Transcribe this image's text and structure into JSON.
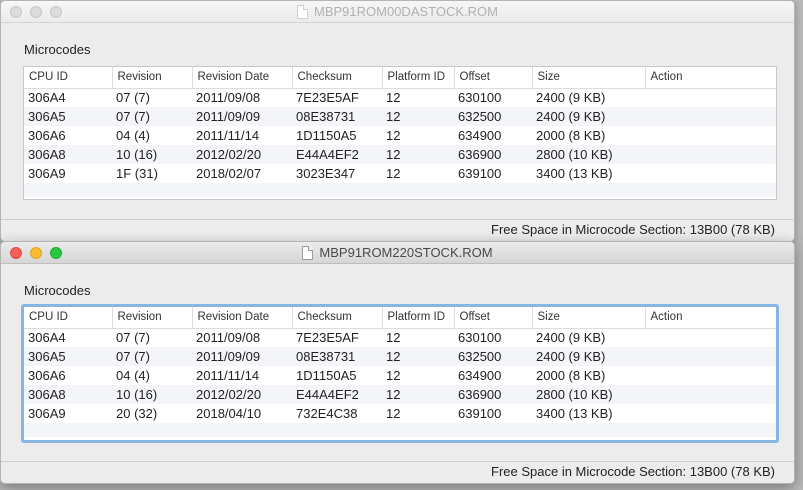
{
  "columns": [
    "CPU ID",
    "Revision",
    "Revision Date",
    "Checksum",
    "Platform ID",
    "Offset",
    "Size",
    "Action"
  ],
  "windows": [
    {
      "title": "MBP91ROM00DASTOCK.ROM",
      "section_label": "Microcodes",
      "rows": [
        [
          "306A4",
          "07 (7)",
          "2011/09/08",
          "7E23E5AF",
          "12",
          "630100",
          "2400 (9 KB)",
          ""
        ],
        [
          "306A5",
          "07 (7)",
          "2011/09/09",
          "08E38731",
          "12",
          "632500",
          "2400 (9 KB)",
          ""
        ],
        [
          "306A6",
          "04 (4)",
          "2011/11/14",
          "1D1150A5",
          "12",
          "634900",
          "2000 (8 KB)",
          ""
        ],
        [
          "306A8",
          "10 (16)",
          "2012/02/20",
          "E44A4EF2",
          "12",
          "636900",
          "2800 (10 KB)",
          ""
        ],
        [
          "306A9",
          "1F (31)",
          "2018/02/07",
          "3023E347",
          "12",
          "639100",
          "3400 (13 KB)",
          ""
        ]
      ],
      "free_space": "Free Space in Microcode Section: 13B00 (78 KB)"
    },
    {
      "title": "MBP91ROM220STOCK.ROM",
      "section_label": "Microcodes",
      "rows": [
        [
          "306A4",
          "07 (7)",
          "2011/09/08",
          "7E23E5AF",
          "12",
          "630100",
          "2400 (9 KB)",
          ""
        ],
        [
          "306A5",
          "07 (7)",
          "2011/09/09",
          "08E38731",
          "12",
          "632500",
          "2400 (9 KB)",
          ""
        ],
        [
          "306A6",
          "04 (4)",
          "2011/11/14",
          "1D1150A5",
          "12",
          "634900",
          "2000 (8 KB)",
          ""
        ],
        [
          "306A8",
          "10 (16)",
          "2012/02/20",
          "E44A4EF2",
          "12",
          "636900",
          "2800 (10 KB)",
          ""
        ],
        [
          "306A9",
          "20 (32)",
          "2018/04/10",
          "732E4C38",
          "12",
          "639100",
          "3400 (13 KB)",
          ""
        ]
      ],
      "free_space": "Free Space in Microcode Section: 13B00 (78 KB)"
    }
  ],
  "colors": {
    "close": "#fc5f57",
    "minimize": "#fdbc2e",
    "zoom": "#28c840",
    "focus_ring": "#87b5e4"
  }
}
